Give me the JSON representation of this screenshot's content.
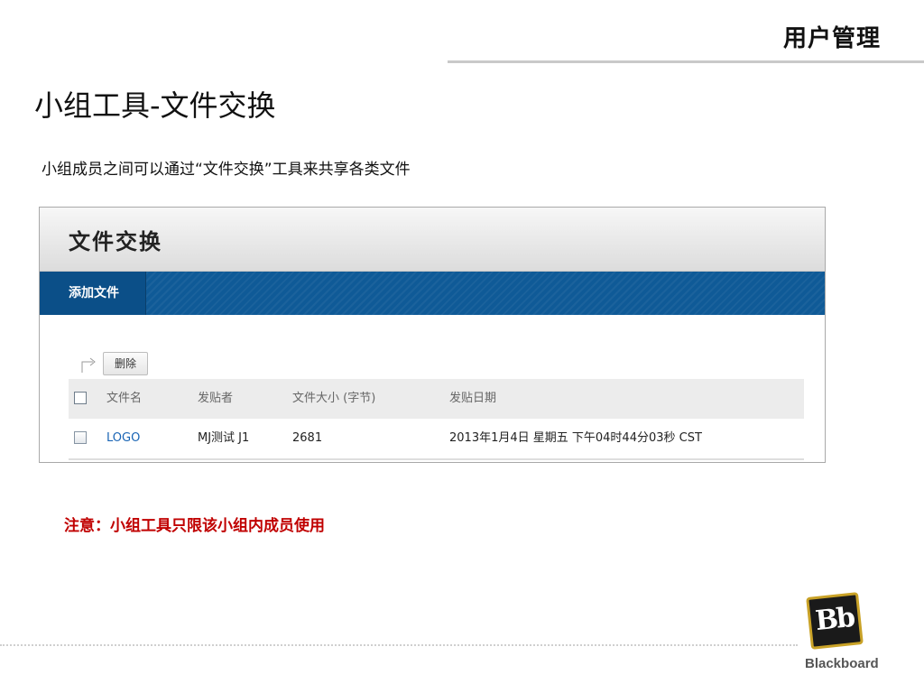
{
  "section_title": "用户管理",
  "slide_title": "小组工具-文件交换",
  "description": "小组成员之间可以通过“文件交换”工具来共享各类文件",
  "panel": {
    "title": "文件交换",
    "add_file_label": "添加文件",
    "delete_label": "删除",
    "columns": {
      "name": "文件名",
      "poster": "发贴者",
      "size": "文件大小 (字节)",
      "date": "发贴日期"
    },
    "rows": [
      {
        "name": "LOGO",
        "poster": "MJ测试 J1",
        "size": "2681",
        "date": "2013年1月4日 星期五 下午04时44分03秒 CST"
      }
    ]
  },
  "note": "注意：小组工具只限该小组内成员使用",
  "brand": {
    "logo_text": "Bb",
    "name": "Blackboard"
  },
  "colors": {
    "action_bar": "#0f5a97",
    "link": "#1a65b5",
    "note": "#c00000",
    "logo_border": "#c9a227"
  }
}
